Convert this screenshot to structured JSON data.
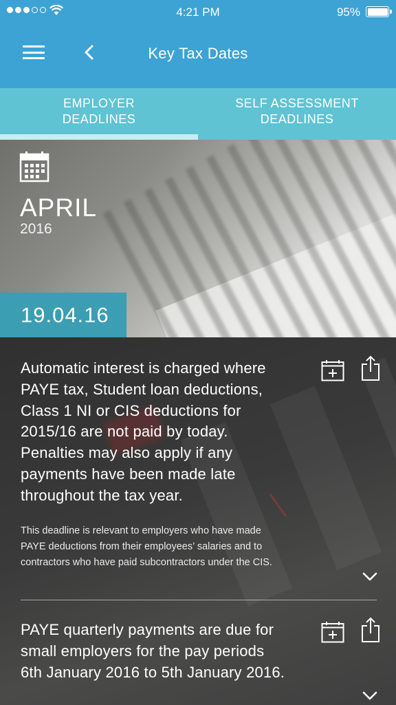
{
  "status_bar": {
    "time": "4:21 PM",
    "battery": "95%"
  },
  "nav": {
    "title": "Key Tax Dates"
  },
  "tabs": [
    {
      "line1": "EMPLOYER",
      "line2": "DEADLINES"
    },
    {
      "line1": "SELF ASSESSMENT",
      "line2": "DEADLINES"
    }
  ],
  "hero": {
    "month": "APRIL",
    "year": "2016",
    "date": "19.04.16"
  },
  "entries": [
    {
      "text": "Automatic interest is charged where PAYE tax, Student loan deductions, Class 1 NI or CIS deductions for 2015/16 are not paid by today. Penalties may also apply if any payments have been made late throughout the tax year.",
      "note": "This deadline is relevant to employers who have made PAYE deductions from their employees’ salaries and to contractors who have paid subcontractors under the CIS."
    },
    {
      "text": "PAYE quarterly payments are due for small employers for the pay periods 6th January 2016 to 5th January 2016.",
      "note": ""
    }
  ],
  "colors": {
    "header": "#3da3d4",
    "tabs": "#5fc3d3",
    "date_badge": "#3b9eb3"
  }
}
